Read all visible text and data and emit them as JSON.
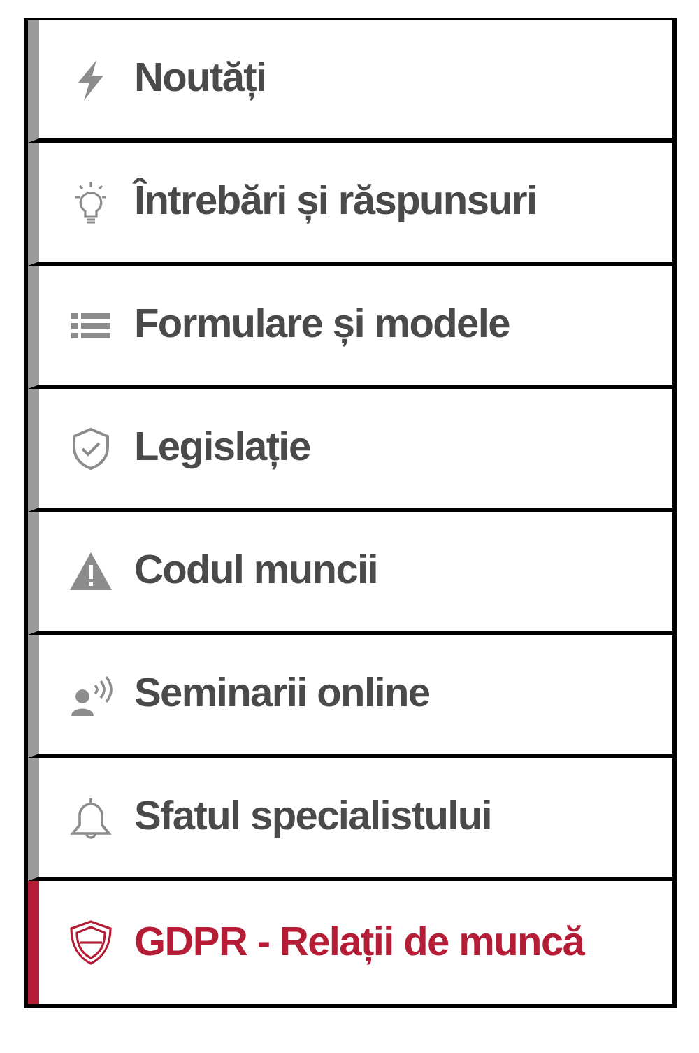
{
  "menu": {
    "items": [
      {
        "label": "Noutăți",
        "kind": "bolt",
        "selected": false
      },
      {
        "label": "Întrebări și răspunsuri",
        "kind": "bulb",
        "selected": false
      },
      {
        "label": "Formulare și modele",
        "kind": "list",
        "selected": false
      },
      {
        "label": "Legislație",
        "kind": "shield",
        "selected": false
      },
      {
        "label": "Codul muncii",
        "kind": "warning",
        "selected": false
      },
      {
        "label": "Seminarii online",
        "kind": "broadcast",
        "selected": false
      },
      {
        "label": "Sfatul specialistului",
        "kind": "bell",
        "selected": false
      },
      {
        "label": "GDPR - Relații de muncă",
        "kind": "badge",
        "selected": true
      }
    ]
  }
}
